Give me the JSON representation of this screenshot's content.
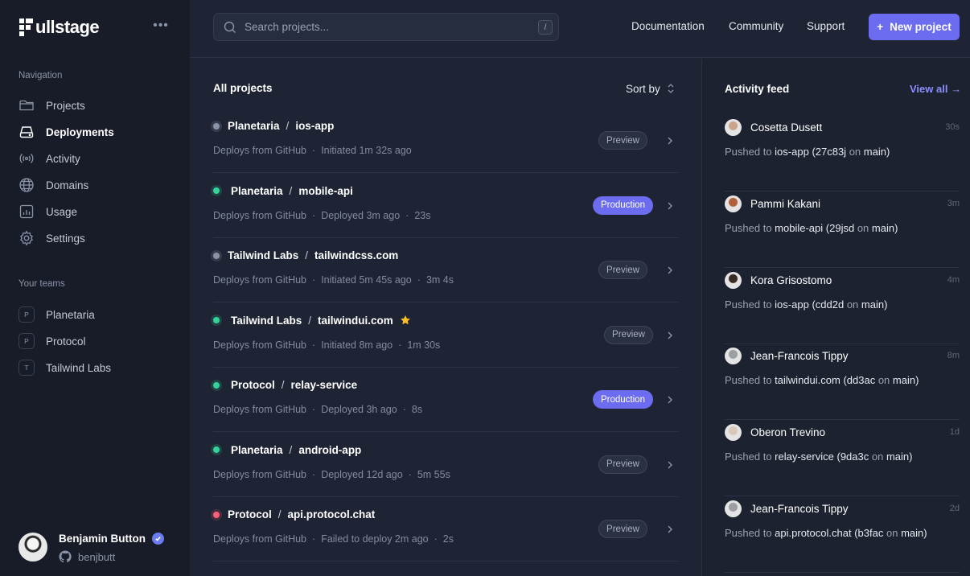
{
  "brand": {
    "name": "ullstage"
  },
  "sidebar": {
    "navigation_label": "Navigation",
    "items": [
      {
        "label": "Projects",
        "icon": "folder-icon"
      },
      {
        "label": "Deployments",
        "icon": "server-icon",
        "active": true
      },
      {
        "label": "Activity",
        "icon": "signal-icon"
      },
      {
        "label": "Domains",
        "icon": "globe-icon"
      },
      {
        "label": "Usage",
        "icon": "chart-icon"
      },
      {
        "label": "Settings",
        "icon": "gear-icon"
      }
    ],
    "teams_label": "Your teams",
    "teams": [
      {
        "initial": "P",
        "name": "Planetaria"
      },
      {
        "initial": "P",
        "name": "Protocol"
      },
      {
        "initial": "T",
        "name": "Tailwind Labs"
      }
    ]
  },
  "user": {
    "name": "Benjamin Button",
    "handle": "benjbutt"
  },
  "header": {
    "search_placeholder": "Search projects...",
    "search_shortcut": "/",
    "links": [
      "Documentation",
      "Community",
      "Support"
    ],
    "new_project_label": "New project",
    "new_project_icon": "+"
  },
  "projects": {
    "title": "All projects",
    "sort_label": "Sort by",
    "rows": [
      {
        "team": "Planetaria",
        "name": "ios-app",
        "status": "preview",
        "meta": [
          "Deploys from GitHub",
          "Initiated 1m 32s ago"
        ],
        "badge": "Preview",
        "badge_type": "preview",
        "starred": false
      },
      {
        "team": "Planetaria",
        "name": "mobile-api",
        "status": "ok",
        "meta": [
          "Deploys from GitHub",
          "Deployed 3m ago",
          "23s"
        ],
        "badge": "Production",
        "badge_type": "production",
        "starred": false
      },
      {
        "team": "Tailwind Labs",
        "name": "tailwindcss.com",
        "status": "preview",
        "meta": [
          "Deploys from GitHub",
          "Initiated 5m 45s ago",
          "3m 4s"
        ],
        "badge": "Preview",
        "badge_type": "preview",
        "starred": false
      },
      {
        "team": "Tailwind Labs",
        "name": "tailwindui.com",
        "status": "ok",
        "meta": [
          "Deploys from GitHub",
          "Initiated 8m ago",
          "1m 30s"
        ],
        "badge": "Preview",
        "badge_type": "preview",
        "starred": true
      },
      {
        "team": "Protocol",
        "name": "relay-service",
        "status": "ok",
        "meta": [
          "Deploys from GitHub",
          "Deployed 3h ago",
          "8s"
        ],
        "badge": "Production",
        "badge_type": "production",
        "starred": false
      },
      {
        "team": "Planetaria",
        "name": "android-app",
        "status": "ok",
        "meta": [
          "Deploys from GitHub",
          "Deployed 12d ago",
          "5m 55s"
        ],
        "badge": "Preview",
        "badge_type": "preview",
        "starred": false
      },
      {
        "team": "Protocol",
        "name": "api.protocol.chat",
        "status": "fail",
        "meta": [
          "Deploys from GitHub",
          "Failed to deploy 2m ago",
          "2s"
        ],
        "badge": "Preview",
        "badge_type": "preview",
        "starred": false
      }
    ]
  },
  "activity": {
    "title": "Activity feed",
    "view_all_label": "View all →",
    "items": [
      {
        "name": "Cosetta Dusett",
        "time": "30s",
        "prefix": "Pushed to",
        "project": "ios-app",
        "commit": "(27c83j",
        "on": "on",
        "branch": "main)",
        "avatar_color": "#c9a48a"
      },
      {
        "name": "Pammi Kakani",
        "time": "3m",
        "prefix": "Pushed to",
        "project": "mobile-api",
        "commit": "(29jsd",
        "on": "on",
        "branch": "main)",
        "avatar_color": "#b0603a"
      },
      {
        "name": "Kora Grisostomo",
        "time": "4m",
        "prefix": "Pushed to",
        "project": "ios-app",
        "commit": "(cdd2d",
        "on": "on",
        "branch": "main)",
        "avatar_color": "#3a2a26"
      },
      {
        "name": "Jean-Francois Tippy",
        "time": "8m",
        "prefix": "Pushed to",
        "project": "tailwindui.com",
        "commit": "(dd3ac",
        "on": "on",
        "branch": "main)",
        "avatar_color": "#9aa0a2"
      },
      {
        "name": "Oberon Trevino",
        "time": "1d",
        "prefix": "Pushed to",
        "project": "relay-service",
        "commit": "(9da3c",
        "on": "on",
        "branch": "main)",
        "avatar_color": "#d8c8bc"
      },
      {
        "name": "Jean-Francois Tippy",
        "time": "2d",
        "prefix": "Pushed to",
        "project": "api.protocol.chat",
        "commit": "(b3fac",
        "on": "on",
        "branch": "main)",
        "avatar_color": "#9aa0a2"
      }
    ]
  },
  "colors": {
    "accent": "#6b6cf0",
    "success": "#34d399",
    "danger": "#fb5f7a",
    "sidebar_bg": "#171c28",
    "main_bg": "#1e2433"
  }
}
